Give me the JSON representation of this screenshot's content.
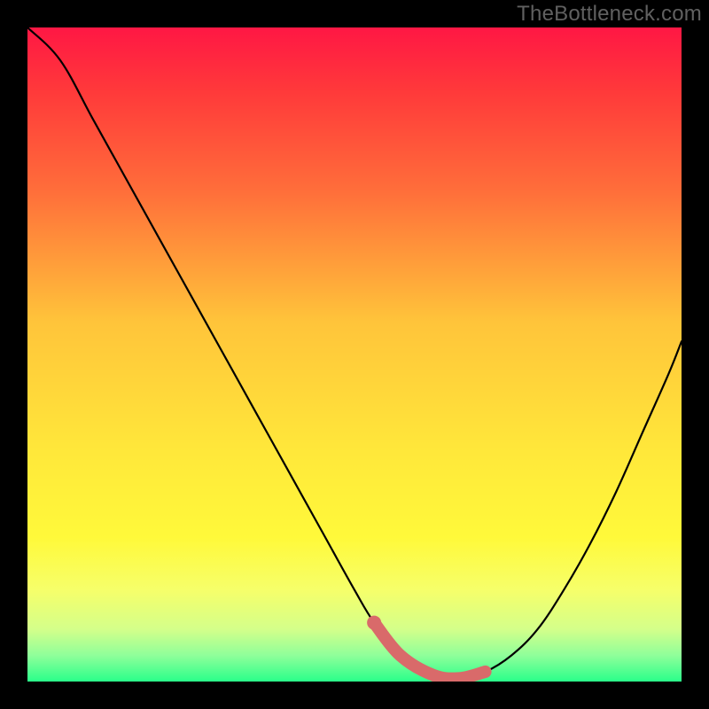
{
  "watermark": "TheBottleneck.com",
  "chart_data": {
    "type": "line",
    "title": "",
    "xlabel": "",
    "ylabel": "",
    "xlim": [
      0,
      100
    ],
    "ylim": [
      0,
      100
    ],
    "series": [
      {
        "name": "bottleneck-curve",
        "color": "#000000",
        "x": [
          0,
          5,
          10,
          15,
          20,
          25,
          30,
          35,
          40,
          45,
          50,
          53,
          57,
          62,
          66,
          70,
          74,
          78,
          82,
          86,
          90,
          94,
          98,
          100
        ],
        "y": [
          100,
          95,
          86,
          77,
          68,
          59,
          50,
          41,
          32,
          23,
          14,
          9,
          4,
          1,
          0.5,
          1.5,
          4,
          8,
          14,
          21,
          29,
          38,
          47,
          52
        ]
      },
      {
        "name": "highlight-band",
        "color": "#d96a6a",
        "x": [
          53,
          57,
          62,
          66,
          70
        ],
        "y": [
          9,
          4,
          1,
          0.5,
          1.5
        ]
      }
    ],
    "gradient_stops": [
      {
        "offset": 0.0,
        "color": "#ff1744"
      },
      {
        "offset": 0.1,
        "color": "#ff3a3a"
      },
      {
        "offset": 0.25,
        "color": "#ff6e3a"
      },
      {
        "offset": 0.45,
        "color": "#ffc43a"
      },
      {
        "offset": 0.65,
        "color": "#ffe83a"
      },
      {
        "offset": 0.78,
        "color": "#fff93a"
      },
      {
        "offset": 0.86,
        "color": "#f6ff6a"
      },
      {
        "offset": 0.92,
        "color": "#d4ff8a"
      },
      {
        "offset": 0.96,
        "color": "#8fff9a"
      },
      {
        "offset": 1.0,
        "color": "#2aff8a"
      }
    ]
  }
}
